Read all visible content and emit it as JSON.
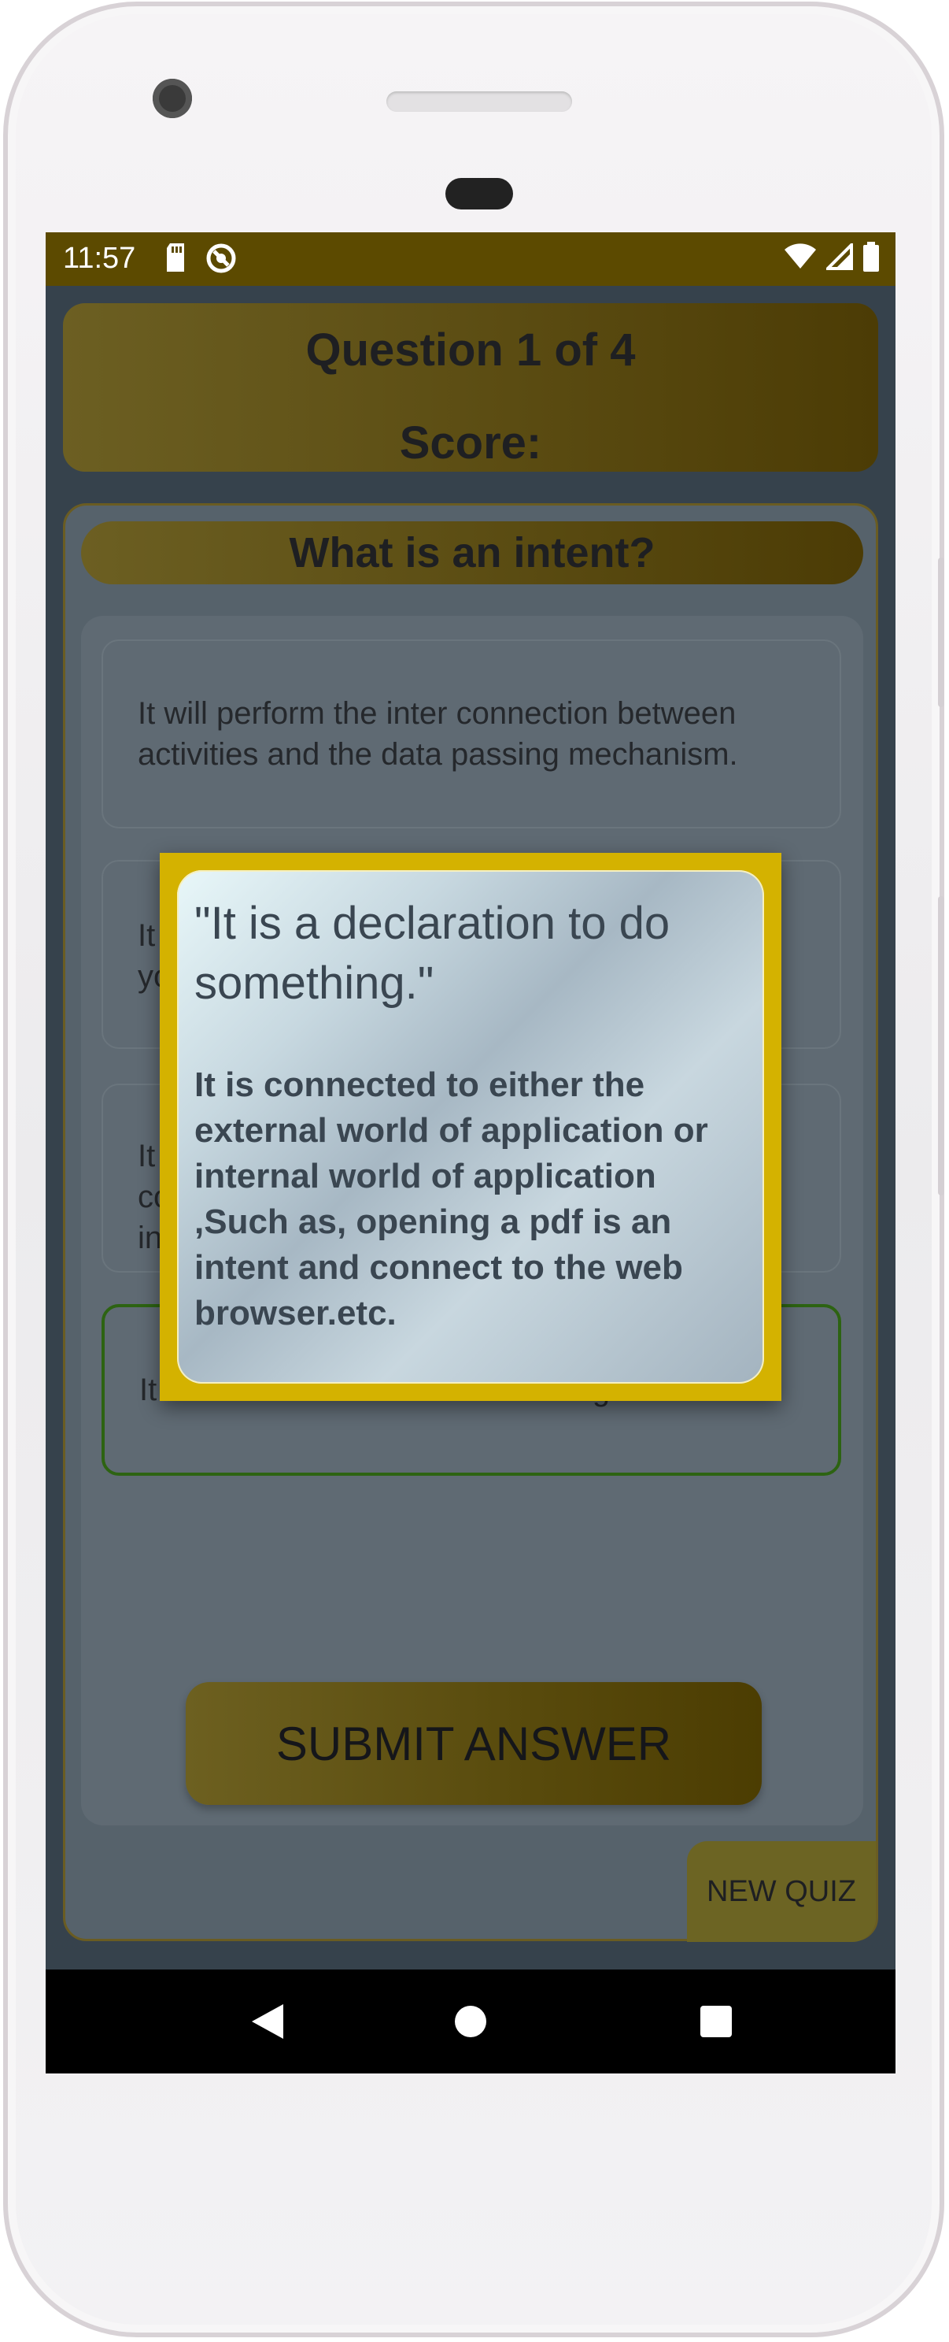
{
  "status_bar": {
    "time": "11:57",
    "icons_left": [
      "sd-card-icon",
      "sync-icon"
    ],
    "icons_right": [
      "wifi-icon",
      "cell-signal-icon",
      "battery-icon"
    ]
  },
  "header": {
    "question_counter": "Question 1 of 4",
    "score_label": "Score:"
  },
  "question": {
    "text": "What is an intent?"
  },
  "options": [
    {
      "text": "It will perform the inter connection between activities and the data passing mechanism.",
      "selected": false
    },
    {
      "text": "It",
      "text2": "yo",
      "selected": false
    },
    {
      "text": "It",
      "text2": "co",
      "text3": "in",
      "selected": false
    },
    {
      "text": "It is a declaration to do something.",
      "selected": true
    }
  ],
  "submit_button": {
    "label": "SUBMIT ANSWER"
  },
  "new_quiz_button": {
    "label": "NEW QUIZ"
  },
  "dialog": {
    "title": "\"It is a declaration to do something.\"",
    "body": "It is connected to either the external world of application or internal world of application ,Such as, opening a pdf is an intent and connect to the web browser.etc."
  },
  "colors": {
    "accent_gold": "#d4b200",
    "status_bar": "#5c4a00",
    "selected_border": "#2d6312"
  }
}
